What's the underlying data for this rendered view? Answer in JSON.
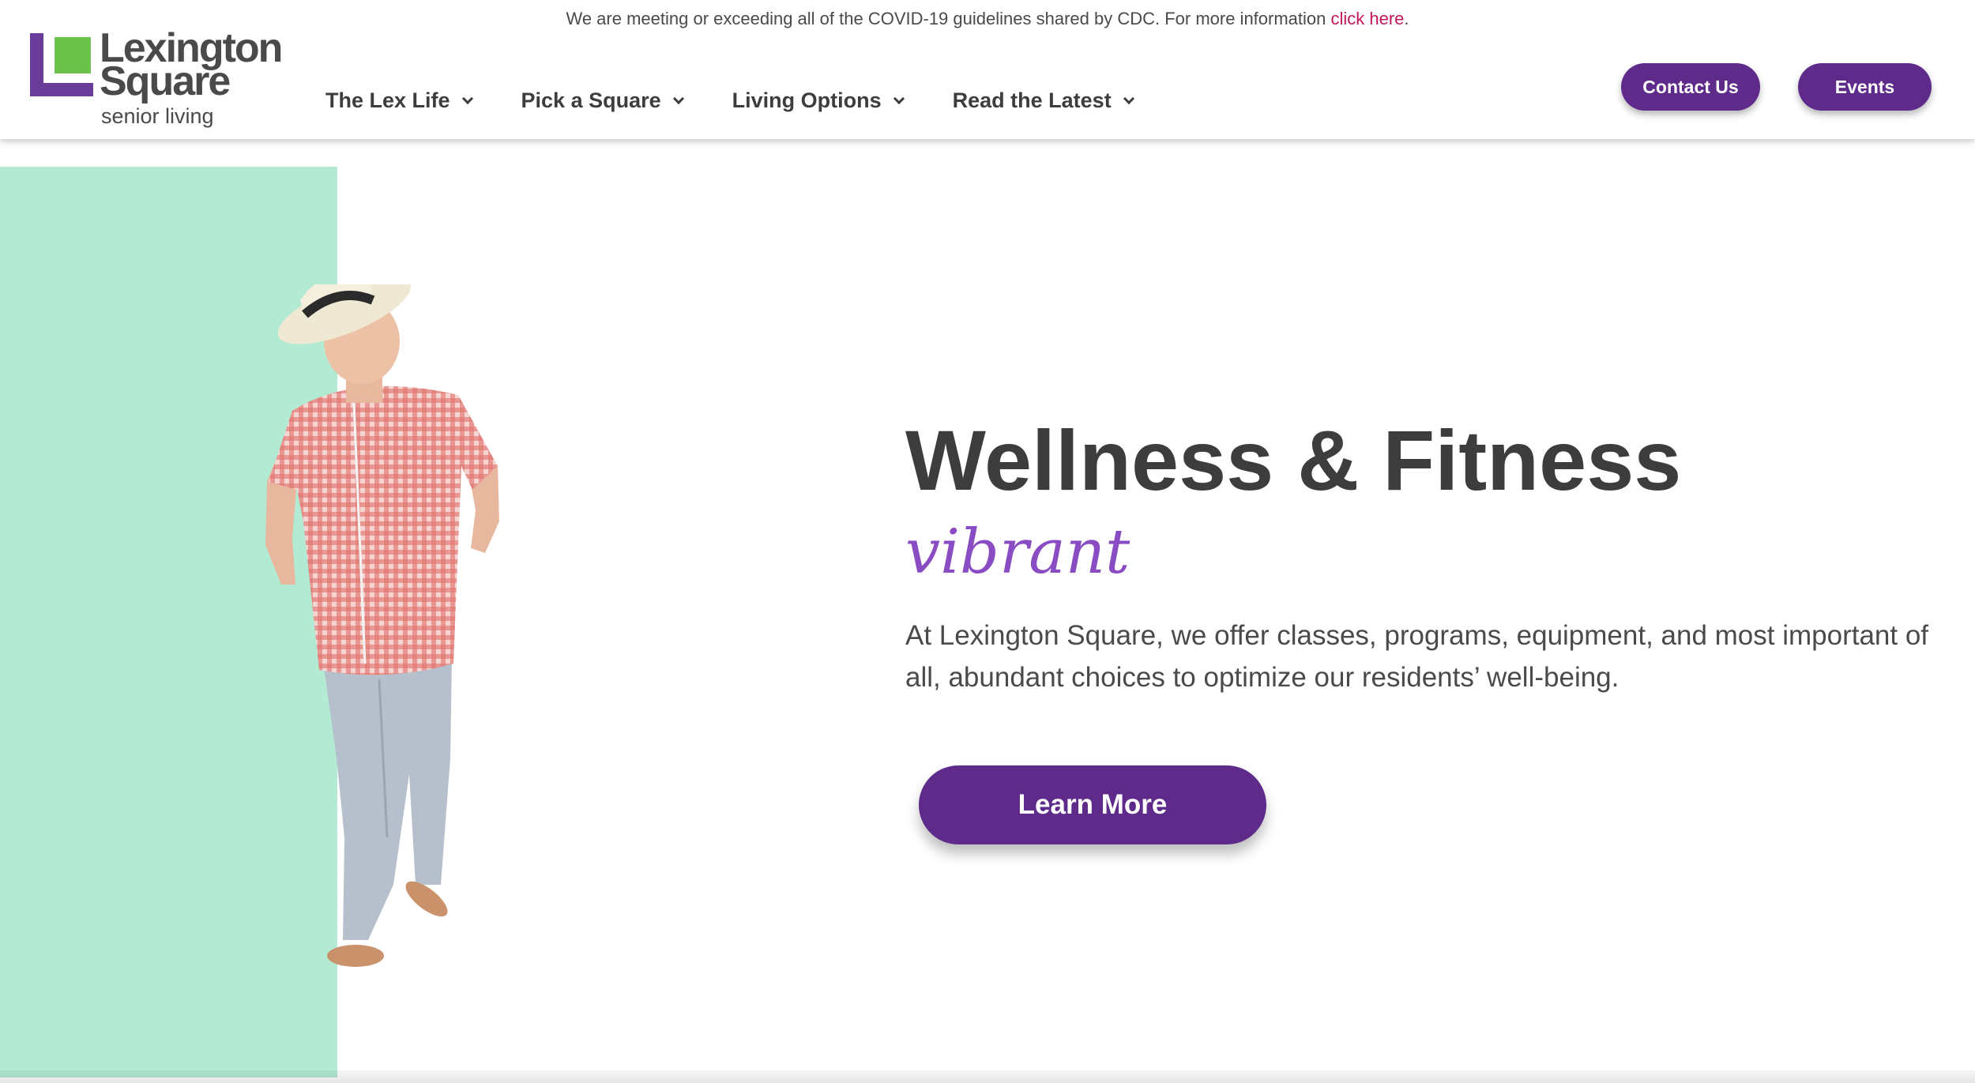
{
  "notice": {
    "text": "We are meeting or exceeding all of the COVID-19 guidelines shared by CDC. For more information ",
    "link": "click here",
    "suffix": "."
  },
  "logo": {
    "line1": "Lexington",
    "line2": "Square",
    "line3": "senior living",
    "colors": {
      "purple": "#6a3d9a",
      "green": "#6cc24a"
    }
  },
  "nav": {
    "items": [
      {
        "label": "The Lex Life",
        "icon": "chevron-down-icon"
      },
      {
        "label": "Pick a Square",
        "icon": "chevron-down-icon"
      },
      {
        "label": "Living Options",
        "icon": "chevron-down-icon"
      },
      {
        "label": "Read the Latest",
        "icon": "chevron-down-icon"
      }
    ]
  },
  "header_buttons": {
    "contact": "Contact Us",
    "events": "Events"
  },
  "hero": {
    "title": "Wellness & Fitness",
    "script": "vibrant",
    "description": "At Lexington Square, we offer classes, programs, equipment, and most important of all, abundant choices to optimize our residents’ well-being.",
    "cta": "Learn More",
    "image": "senior-man-in-hat-walking"
  },
  "colors": {
    "accent": "#5e2b8a",
    "mint": "#b2ead4",
    "link": "#c2185b",
    "script": "#8a4cc2"
  }
}
